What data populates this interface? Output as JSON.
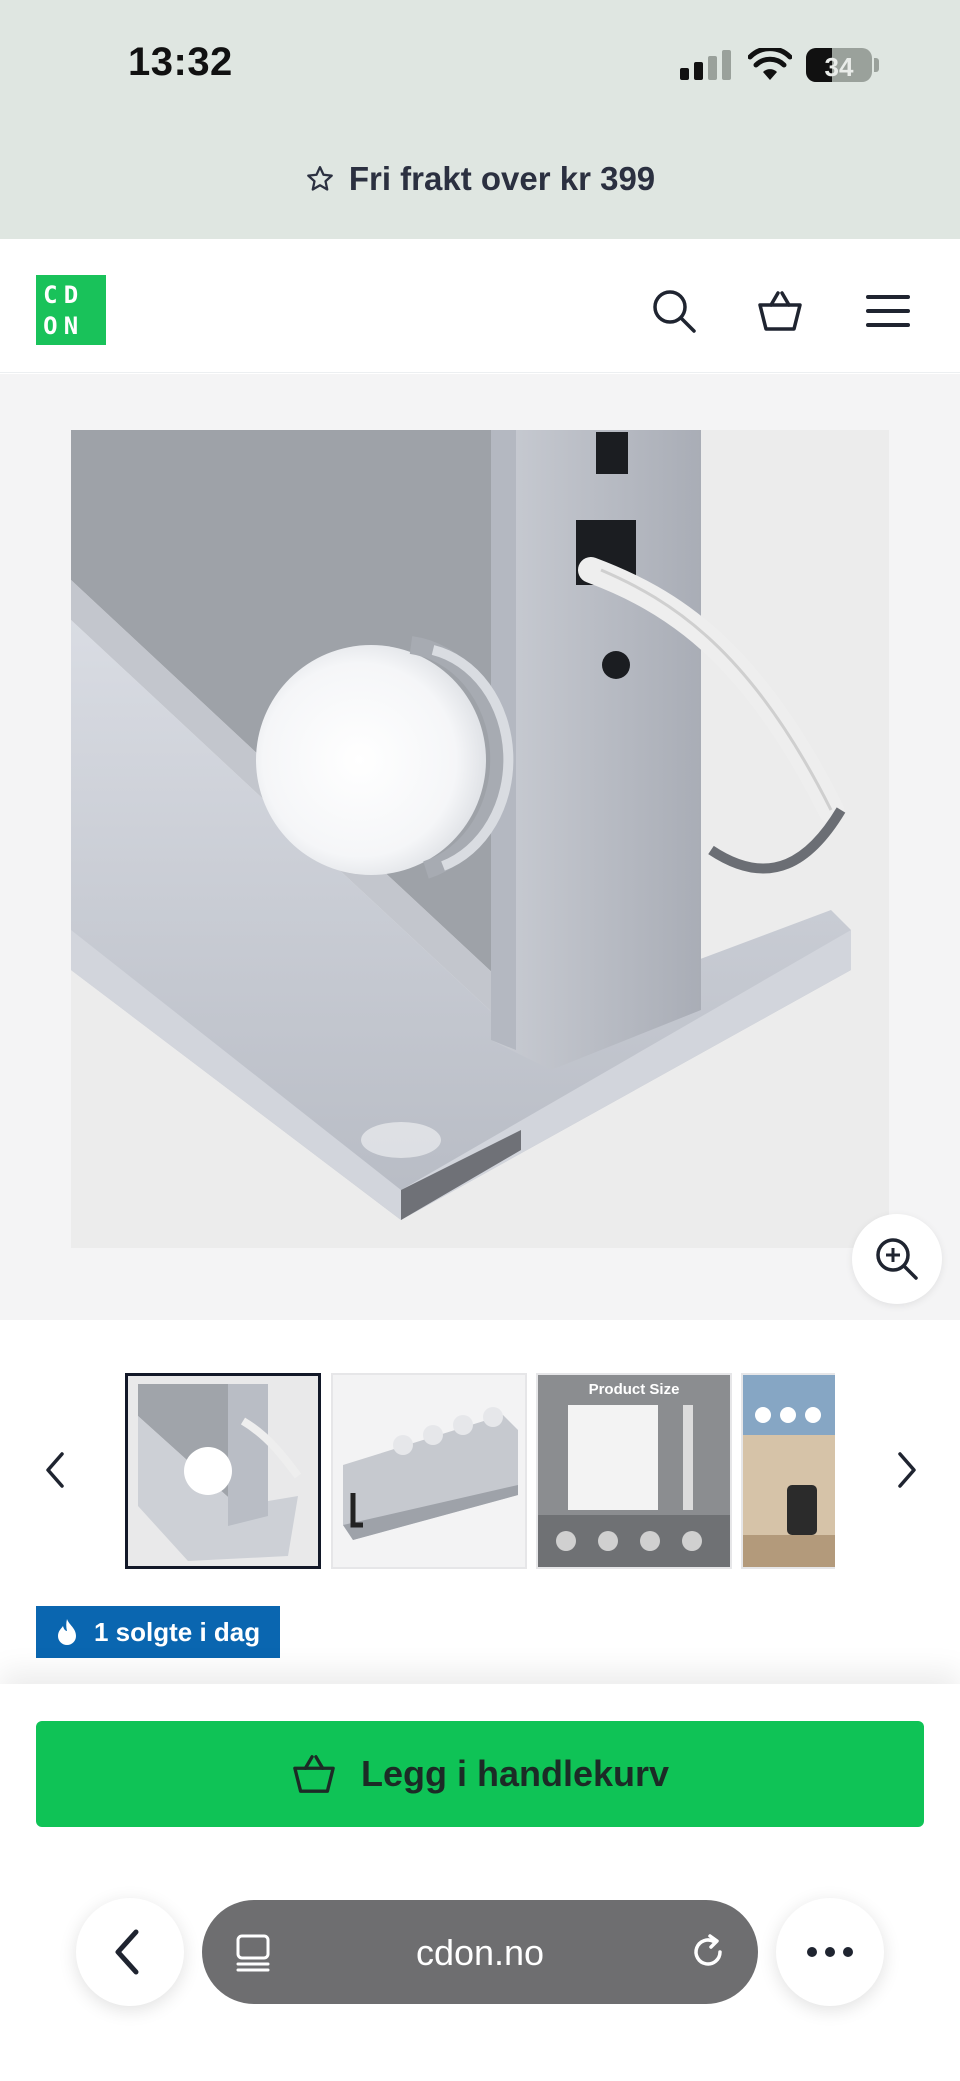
{
  "status_bar": {
    "time": "13:32",
    "battery": "34"
  },
  "promo": {
    "text": "Fri frakt over kr 399",
    "icon": "star-icon"
  },
  "header": {
    "logo_letters": [
      "C",
      "D",
      "",
      "O",
      "N",
      ""
    ],
    "icons": [
      "search-icon",
      "basket-icon",
      "menu-icon"
    ]
  },
  "product": {
    "main_image": "vanity-mirror-closeup",
    "thumbnails": [
      {
        "name": "mirror-closeup",
        "active": true
      },
      {
        "name": "mirror-side"
      },
      {
        "name": "product-size",
        "caption": "Product Size"
      },
      {
        "name": "mirror-room"
      }
    ],
    "sold_badge": "1 solgte i dag"
  },
  "cta": {
    "label": "Legg i handlekurv"
  },
  "browser": {
    "url": "cdon.no"
  },
  "colors": {
    "accent": "#0fc356",
    "badge": "#0a66b0",
    "promo_bg": "#dfe6e1"
  }
}
